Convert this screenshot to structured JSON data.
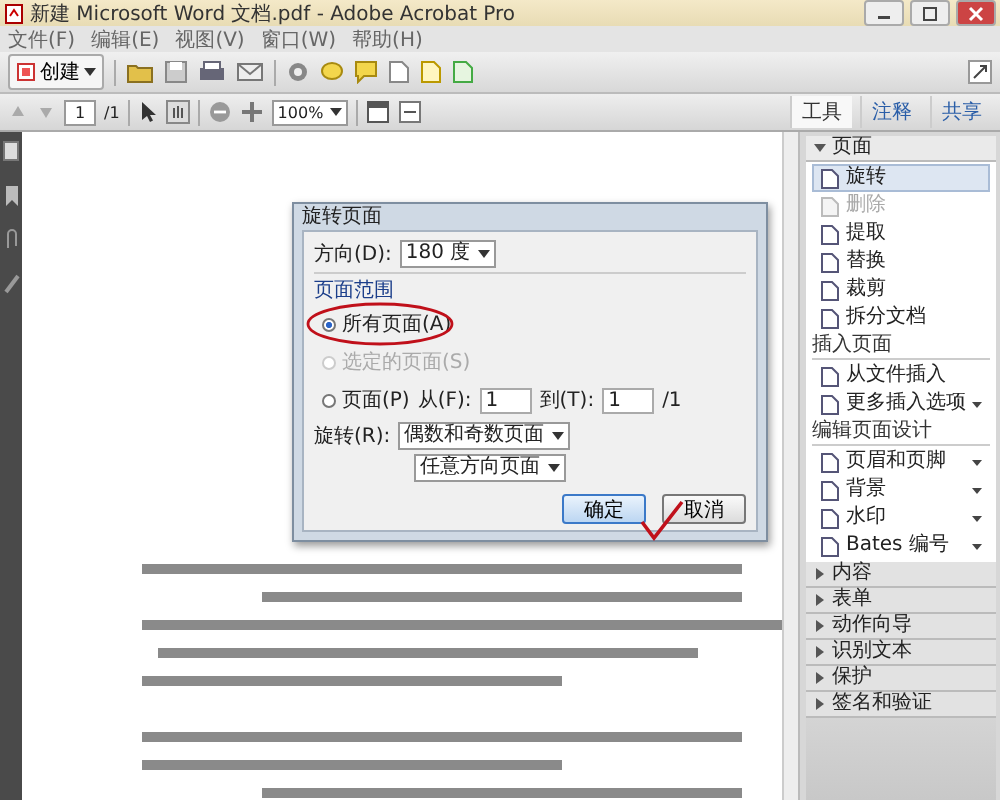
{
  "window": {
    "title": "新建 Microsoft Word 文档.pdf - Adobe Acrobat Pro"
  },
  "menu": [
    "文件(F)",
    "编辑(E)",
    "视图(V)",
    "窗口(W)",
    "帮助(H)"
  ],
  "toolbar": {
    "create_label": "创建"
  },
  "nav": {
    "page": "1",
    "total": "/1",
    "zoom": "100%"
  },
  "tabs": [
    {
      "label": "工具",
      "selected": true
    },
    {
      "label": "注释",
      "selected": false
    },
    {
      "label": "共享",
      "selected": false
    }
  ],
  "panel": {
    "sections": [
      {
        "title": "页面",
        "expanded": true,
        "groups": [
          {
            "items": [
              {
                "label": "旋转",
                "selected": true,
                "disabled": false,
                "dropdown": false
              },
              {
                "label": "删除",
                "selected": false,
                "disabled": true,
                "dropdown": false
              },
              {
                "label": "提取",
                "selected": false,
                "disabled": false,
                "dropdown": false
              },
              {
                "label": "替换",
                "selected": false,
                "disabled": false,
                "dropdown": false
              },
              {
                "label": "裁剪",
                "selected": false,
                "disabled": false,
                "dropdown": false
              },
              {
                "label": "拆分文档",
                "selected": false,
                "disabled": false,
                "dropdown": false
              }
            ]
          },
          {
            "heading": "插入页面",
            "items": [
              {
                "label": "从文件插入",
                "selected": false,
                "disabled": false,
                "dropdown": false
              },
              {
                "label": "更多插入选项",
                "selected": false,
                "disabled": false,
                "dropdown": true
              }
            ]
          },
          {
            "heading": "编辑页面设计",
            "items": [
              {
                "label": "页眉和页脚",
                "selected": false,
                "disabled": false,
                "dropdown": true
              },
              {
                "label": "背景",
                "selected": false,
                "disabled": false,
                "dropdown": true
              },
              {
                "label": "水印",
                "selected": false,
                "disabled": false,
                "dropdown": true
              },
              {
                "label": "Bates 编号",
                "selected": false,
                "disabled": false,
                "dropdown": true
              }
            ]
          }
        ]
      },
      {
        "title": "内容",
        "expanded": false
      },
      {
        "title": "表单",
        "expanded": false
      },
      {
        "title": "动作向导",
        "expanded": false
      },
      {
        "title": "识别文本",
        "expanded": false
      },
      {
        "title": "保护",
        "expanded": false
      },
      {
        "title": "签名和验证",
        "expanded": false
      }
    ]
  },
  "dialog": {
    "title": "旋转页面",
    "direction": {
      "label": "方向(D):",
      "value": "180 度"
    },
    "range": {
      "label": "页面范围",
      "options": [
        {
          "label": "所有页面(A)",
          "selected": true,
          "disabled": false
        },
        {
          "label": "选定的页面(S)",
          "selected": false,
          "disabled": true
        },
        {
          "label": "页面(P)",
          "selected": false,
          "disabled": false
        }
      ]
    },
    "from": {
      "label": "从(F):",
      "value": "1"
    },
    "to": {
      "label": "到(T):",
      "value": "1"
    },
    "total": "/1",
    "rotate": {
      "label": "旋转(R):",
      "value": "偶数和奇数页面"
    },
    "orientation_value": "任意方向页面",
    "buttons": [
      {
        "label": "确定",
        "default": true
      },
      {
        "label": "取消",
        "default": false
      }
    ]
  }
}
